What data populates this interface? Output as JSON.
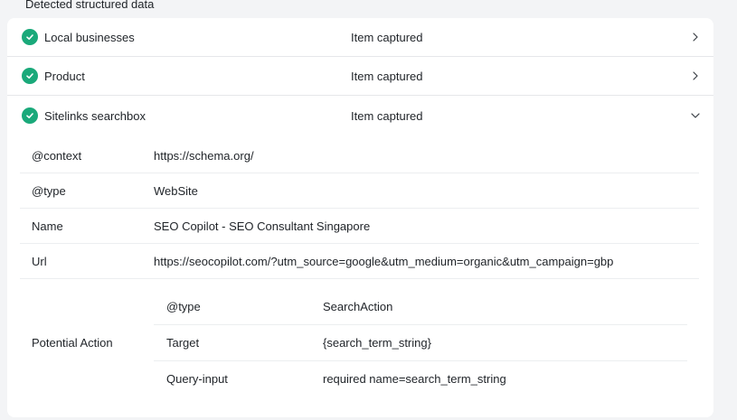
{
  "heading": "Detected structured data",
  "items": [
    {
      "title": "Local businesses",
      "status": "Item captured",
      "expanded": false
    },
    {
      "title": "Product",
      "status": "Item captured",
      "expanded": false
    },
    {
      "title": "Sitelinks searchbox",
      "status": "Item captured",
      "expanded": true
    }
  ],
  "properties": [
    {
      "key": "@context",
      "value": "https://schema.org/"
    },
    {
      "key": "@type",
      "value": "WebSite"
    },
    {
      "key": "Name",
      "value": "SEO Copilot - SEO Consultant Singapore"
    },
    {
      "key": "Url",
      "value": "https://seocopilot.com/?utm_source=google&utm_medium=organic&utm_campaign=gbp"
    }
  ],
  "potential_action": {
    "label": "Potential Action",
    "rows": [
      {
        "key": "@type",
        "value": "SearchAction"
      },
      {
        "key": "Target",
        "value": "{search_term_string}"
      },
      {
        "key": "Query-input",
        "value": "required name=search_term_string"
      }
    ]
  },
  "colors": {
    "check": "#1aa97a",
    "background": "#f3f4f6",
    "card": "#ffffff"
  },
  "icons": {
    "status": "check-circle-icon",
    "collapsed": "chevron-right-icon",
    "expanded": "chevron-down-icon"
  }
}
